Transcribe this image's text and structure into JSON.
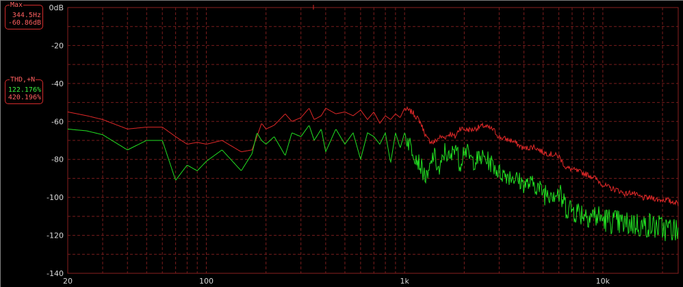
{
  "max_readout": {
    "title": "Max",
    "frequency": "344.5Hz",
    "level": "-60.86dB"
  },
  "thd_readout": {
    "title": "THD,+N",
    "green_value": "122.176%",
    "red_value": "420.196%"
  },
  "colors": {
    "background": "#000000",
    "grid": "#7a1d1d",
    "axis_text": "#d8d8d8",
    "red_trace": "#e02828",
    "green_trace": "#22e022"
  },
  "chart_data": {
    "type": "line",
    "x_scale": "log",
    "xlim": [
      20,
      24000
    ],
    "ylim": [
      -140,
      0
    ],
    "y_ticks": [
      {
        "value": 0,
        "label": "0dB"
      },
      {
        "value": -20,
        "label": "-20"
      },
      {
        "value": -40,
        "label": "-40"
      },
      {
        "value": -60,
        "label": "-60"
      },
      {
        "value": -80,
        "label": "-80"
      },
      {
        "value": -100,
        "label": "-100"
      },
      {
        "value": -120,
        "label": "-120"
      },
      {
        "value": -140,
        "label": "-140"
      }
    ],
    "x_ticks": [
      {
        "value": 20,
        "label": "20"
      },
      {
        "value": 100,
        "label": "100"
      },
      {
        "value": 1000,
        "label": "1k"
      },
      {
        "value": 10000,
        "label": "10k"
      }
    ],
    "series": [
      {
        "color": "#e02828",
        "x": [
          20,
          25,
          30,
          40,
          50,
          60,
          70,
          80,
          90,
          100,
          120,
          150,
          170,
          180,
          190,
          200,
          220,
          250,
          270,
          300,
          330,
          350,
          380,
          400,
          450,
          500,
          550,
          600,
          650,
          700,
          750,
          800,
          850,
          900,
          950,
          1000,
          1100,
          1200,
          1300,
          1400,
          1500,
          1600,
          1700,
          1800,
          1900,
          2000,
          2200,
          2500,
          2800,
          3000,
          3500,
          4000,
          4500,
          5000,
          5500,
          6000,
          6500,
          7000,
          8000,
          9000,
          10000,
          11000,
          12000,
          13000,
          14000,
          15000,
          16000,
          17000,
          18000,
          19000,
          20000,
          21000,
          22000,
          23000,
          24000
        ],
        "y": [
          -55,
          -57,
          -59,
          -64,
          -63,
          -63,
          -68,
          -72,
          -71,
          -72,
          -70,
          -76,
          -75,
          -68,
          -61,
          -64,
          -62,
          -56,
          -60,
          -58,
          -53,
          -59,
          -57,
          -53,
          -56,
          -55,
          -57,
          -54,
          -59,
          -55,
          -61,
          -57,
          -59,
          -56,
          -58,
          -53,
          -55,
          -60,
          -69,
          -71,
          -68,
          -68,
          -66,
          -68,
          -63,
          -64,
          -64,
          -62,
          -64,
          -68,
          -70,
          -74,
          -73,
          -76,
          -77,
          -78,
          -84,
          -85,
          -87,
          -89,
          -93,
          -95,
          -96,
          -98,
          -97,
          -99,
          -100,
          -100,
          -100,
          -101,
          -101,
          -101,
          -102,
          -102,
          -103
        ]
      },
      {
        "color": "#22e022",
        "x": [
          20,
          25,
          30,
          40,
          50,
          60,
          70,
          80,
          90,
          100,
          120,
          150,
          170,
          180,
          190,
          200,
          220,
          250,
          270,
          300,
          330,
          350,
          380,
          400,
          450,
          500,
          550,
          600,
          650,
          700,
          750,
          800,
          850,
          900,
          950,
          1000,
          1100,
          1200,
          1300,
          1400,
          1500,
          1600,
          1700,
          1800,
          1900,
          2000,
          2200,
          2500,
          2800,
          3000,
          3500,
          4000,
          4500,
          5000,
          5500,
          6000,
          6500,
          7000,
          8000,
          9000,
          10000,
          11000,
          12000,
          13000,
          14000,
          15000,
          16000,
          17000,
          18000,
          19000,
          20000,
          21000,
          22000,
          23000,
          24000
        ],
        "y": [
          -64,
          -65,
          -67,
          -75,
          -70,
          -70,
          -91,
          -83,
          -86,
          -81,
          -75,
          -86,
          -77,
          -66,
          -70,
          -72,
          -68,
          -78,
          -66,
          -68,
          -62,
          -70,
          -64,
          -76,
          -64,
          -72,
          -66,
          -80,
          -66,
          -68,
          -72,
          -66,
          -82,
          -66,
          -74,
          -66,
          -74,
          -82,
          -90,
          -76,
          -86,
          -74,
          -80,
          -70,
          -82,
          -73,
          -80,
          -78,
          -82,
          -86,
          -88,
          -92,
          -92,
          -96,
          -95,
          -97,
          -103,
          -105,
          -107,
          -108,
          -110,
          -111,
          -112,
          -113,
          -112,
          -113,
          -114,
          -113,
          -114,
          -114,
          -115,
          -115,
          -115,
          -116,
          -116
        ]
      }
    ]
  }
}
